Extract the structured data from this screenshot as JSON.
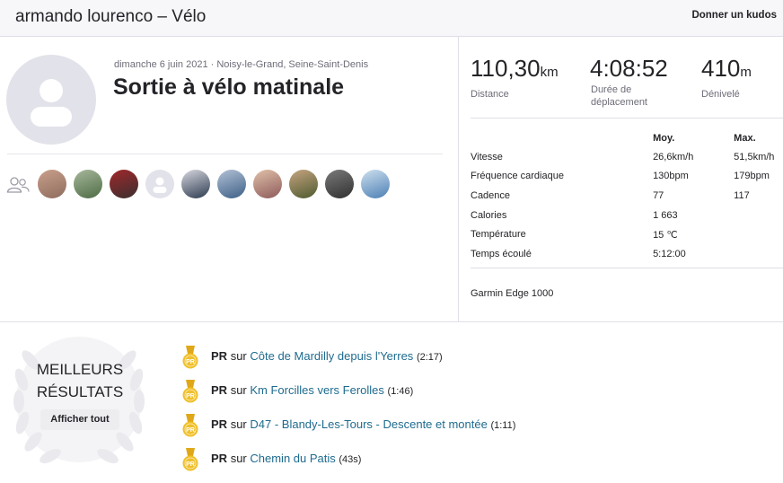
{
  "header": {
    "title": "armando lourenco – Vélo",
    "kudos_label": "Donner un kudos"
  },
  "activity": {
    "date_location": "dimanche 6 juin 2021 · Noisy-le-Grand, Seine-Saint-Denis",
    "title": "Sortie à vélo matinale",
    "avatar_icon": "user-placeholder-icon"
  },
  "group": {
    "icon": "group-icon",
    "athletes": [
      {
        "name": "athlete-1",
        "colors": [
          "#8e6c5e",
          "#c9a08b"
        ]
      },
      {
        "name": "athlete-2",
        "colors": [
          "#4e6b45",
          "#a7b89b"
        ]
      },
      {
        "name": "athlete-3",
        "colors": [
          "#3b2f2f",
          "#a0282b"
        ]
      },
      {
        "name": "athlete-4",
        "placeholder": true
      },
      {
        "name": "athlete-5",
        "colors": [
          "#2b3a4f",
          "#d8d8e0"
        ]
      },
      {
        "name": "athlete-6",
        "colors": [
          "#3d5f86",
          "#b3c2d6"
        ]
      },
      {
        "name": "athlete-7",
        "colors": [
          "#8d5a5a",
          "#e0c1a9"
        ]
      },
      {
        "name": "athlete-8",
        "colors": [
          "#4e5a2f",
          "#c6a480"
        ]
      },
      {
        "name": "athlete-9",
        "colors": [
          "#303030",
          "#7a7a7a"
        ]
      },
      {
        "name": "athlete-10",
        "colors": [
          "#4b7fb5",
          "#cfe0ee"
        ]
      }
    ]
  },
  "stats": {
    "distance": {
      "value": "110,30",
      "unit": "km",
      "label": "Distance"
    },
    "moving_time": {
      "value": "4:08:52",
      "label_line1": "Durée de",
      "label_line2": "déplacement"
    },
    "elevation": {
      "value": "410",
      "unit": "m",
      "label": "Dénivelé"
    }
  },
  "table": {
    "headers": {
      "avg": "Moy.",
      "max": "Max."
    },
    "rows": [
      {
        "name": "Vitesse",
        "avg": "26,6km/h",
        "max": "51,5km/h"
      },
      {
        "name": "Fréquence cardiaque",
        "avg": "130bpm",
        "max": "179bpm"
      },
      {
        "name": "Cadence",
        "avg": "77",
        "max": "117"
      },
      {
        "name": "Calories",
        "avg": "1 663",
        "max": ""
      },
      {
        "name": "Température",
        "avg": "15 ℃",
        "max": ""
      },
      {
        "name": "Temps écoulé",
        "avg": "5:12:00",
        "max": ""
      }
    ]
  },
  "device": "Garmin Edge 1000",
  "best_results": {
    "title_line1": "MEILLEURS",
    "title_line2": "RÉSULTATS",
    "show_all_label": "Afficher tout",
    "medal_color": "#f0c02c",
    "items": [
      {
        "badge": "PR",
        "word": "sur",
        "segment": "Côte de Mardilly depuis l'Yerres",
        "time": "(2:17)"
      },
      {
        "badge": "PR",
        "word": "sur",
        "segment": "Km Forcilles vers Ferolles",
        "time": "(1:46)"
      },
      {
        "badge": "PR",
        "word": "sur",
        "segment": "D47 - Blandy-Les-Tours - Descente et montée",
        "time": "(1:11)"
      },
      {
        "badge": "PR",
        "word": "sur",
        "segment": "Chemin du Patis",
        "time": "(43s)"
      }
    ]
  }
}
